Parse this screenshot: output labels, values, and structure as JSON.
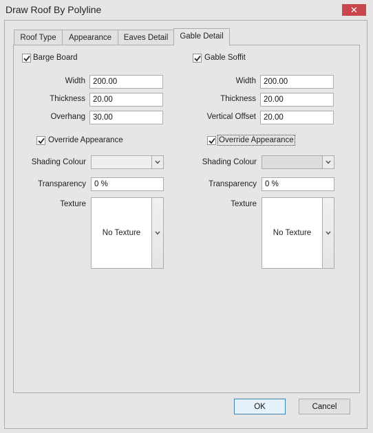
{
  "window": {
    "title": "Draw Roof By Polyline",
    "close_icon": "close-icon",
    "close_color": "#c9474b"
  },
  "tabs": [
    {
      "label": "Roof Type",
      "active": false
    },
    {
      "label": "Appearance",
      "active": false
    },
    {
      "label": "Eaves Detail",
      "active": false
    },
    {
      "label": "Gable Detail",
      "active": true
    }
  ],
  "barge_board": {
    "label": "Barge Board",
    "checked": true,
    "fields": [
      {
        "label": "Width",
        "value": "200.00"
      },
      {
        "label": "Thickness",
        "value": "20.00"
      },
      {
        "label": "Overhang",
        "value": "30.00"
      }
    ],
    "override": {
      "label": "Override Appearance",
      "checked": true
    },
    "shading_colour": {
      "label": "Shading Colour",
      "value": ""
    },
    "transparency": {
      "label": "Transparency",
      "value": "0 %"
    },
    "texture": {
      "label": "Texture",
      "value": "No Texture"
    }
  },
  "gable_soffit": {
    "label": "Gable Soffit",
    "checked": true,
    "fields": [
      {
        "label": "Width",
        "value": "200.00"
      },
      {
        "label": "Thickness",
        "value": "20.00"
      },
      {
        "label": "Vertical Offset",
        "value": "20.00"
      }
    ],
    "override": {
      "label": "Override Appearance",
      "checked": true,
      "focused": true
    },
    "shading_colour": {
      "label": "Shading Colour",
      "value": ""
    },
    "transparency": {
      "label": "Transparency",
      "value": "0 %"
    },
    "texture": {
      "label": "Texture",
      "value": "No Texture"
    }
  },
  "buttons": {
    "ok": "OK",
    "cancel": "Cancel",
    "default_border_color": "#3c7fb1"
  }
}
